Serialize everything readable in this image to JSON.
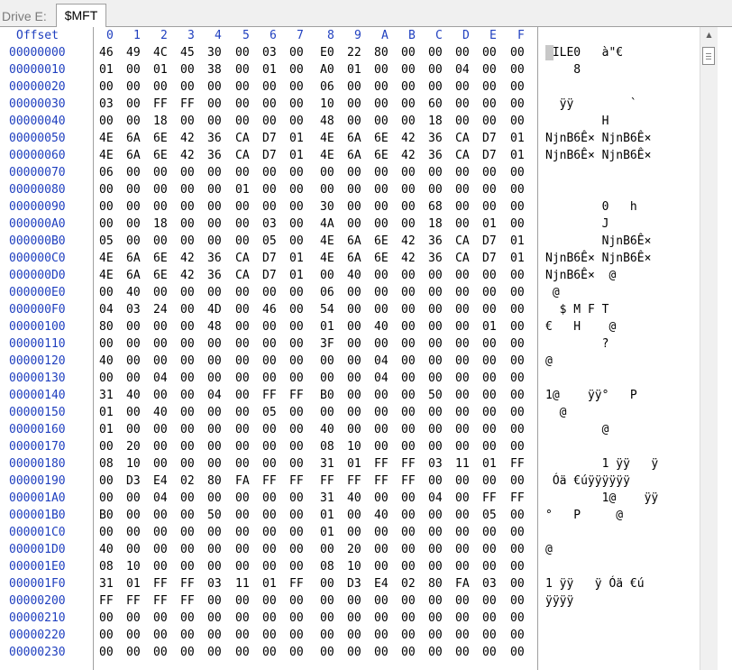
{
  "tabs": {
    "drive_label": "Drive E:",
    "active_label": "$MFT"
  },
  "header": {
    "offset_label": "Offset",
    "columns": [
      "0",
      "1",
      "2",
      "3",
      "4",
      "5",
      "6",
      "7",
      "8",
      "9",
      "A",
      "B",
      "C",
      "D",
      "E",
      "F"
    ]
  },
  "rows": [
    {
      "offset": "00000000",
      "hex": [
        "46",
        "49",
        "4C",
        "45",
        "30",
        "00",
        "03",
        "00",
        "E0",
        "22",
        "80",
        "00",
        "00",
        "00",
        "00",
        "00"
      ],
      "ascii": "FILE0   à\"€"
    },
    {
      "offset": "00000010",
      "hex": [
        "01",
        "00",
        "01",
        "00",
        "38",
        "00",
        "01",
        "00",
        "A0",
        "01",
        "00",
        "00",
        "00",
        "04",
        "00",
        "00"
      ],
      "ascii": "    8"
    },
    {
      "offset": "00000020",
      "hex": [
        "00",
        "00",
        "00",
        "00",
        "00",
        "00",
        "00",
        "00",
        "06",
        "00",
        "00",
        "00",
        "00",
        "00",
        "00",
        "00"
      ],
      "ascii": ""
    },
    {
      "offset": "00000030",
      "hex": [
        "03",
        "00",
        "FF",
        "FF",
        "00",
        "00",
        "00",
        "00",
        "10",
        "00",
        "00",
        "00",
        "60",
        "00",
        "00",
        "00"
      ],
      "ascii": "  ÿÿ        `"
    },
    {
      "offset": "00000040",
      "hex": [
        "00",
        "00",
        "18",
        "00",
        "00",
        "00",
        "00",
        "00",
        "48",
        "00",
        "00",
        "00",
        "18",
        "00",
        "00",
        "00"
      ],
      "ascii": "        H"
    },
    {
      "offset": "00000050",
      "hex": [
        "4E",
        "6A",
        "6E",
        "42",
        "36",
        "CA",
        "D7",
        "01",
        "4E",
        "6A",
        "6E",
        "42",
        "36",
        "CA",
        "D7",
        "01"
      ],
      "ascii": "NjnB6Ê× NjnB6Ê×"
    },
    {
      "offset": "00000060",
      "hex": [
        "4E",
        "6A",
        "6E",
        "42",
        "36",
        "CA",
        "D7",
        "01",
        "4E",
        "6A",
        "6E",
        "42",
        "36",
        "CA",
        "D7",
        "01"
      ],
      "ascii": "NjnB6Ê× NjnB6Ê×"
    },
    {
      "offset": "00000070",
      "hex": [
        "06",
        "00",
        "00",
        "00",
        "00",
        "00",
        "00",
        "00",
        "00",
        "00",
        "00",
        "00",
        "00",
        "00",
        "00",
        "00"
      ],
      "ascii": ""
    },
    {
      "offset": "00000080",
      "hex": [
        "00",
        "00",
        "00",
        "00",
        "00",
        "01",
        "00",
        "00",
        "00",
        "00",
        "00",
        "00",
        "00",
        "00",
        "00",
        "00"
      ],
      "ascii": ""
    },
    {
      "offset": "00000090",
      "hex": [
        "00",
        "00",
        "00",
        "00",
        "00",
        "00",
        "00",
        "00",
        "30",
        "00",
        "00",
        "00",
        "68",
        "00",
        "00",
        "00"
      ],
      "ascii": "        0   h"
    },
    {
      "offset": "000000A0",
      "hex": [
        "00",
        "00",
        "18",
        "00",
        "00",
        "00",
        "03",
        "00",
        "4A",
        "00",
        "00",
        "00",
        "18",
        "00",
        "01",
        "00"
      ],
      "ascii": "        J"
    },
    {
      "offset": "000000B0",
      "hex": [
        "05",
        "00",
        "00",
        "00",
        "00",
        "00",
        "05",
        "00",
        "4E",
        "6A",
        "6E",
        "42",
        "36",
        "CA",
        "D7",
        "01"
      ],
      "ascii": "        NjnB6Ê×"
    },
    {
      "offset": "000000C0",
      "hex": [
        "4E",
        "6A",
        "6E",
        "42",
        "36",
        "CA",
        "D7",
        "01",
        "4E",
        "6A",
        "6E",
        "42",
        "36",
        "CA",
        "D7",
        "01"
      ],
      "ascii": "NjnB6Ê× NjnB6Ê×"
    },
    {
      "offset": "000000D0",
      "hex": [
        "4E",
        "6A",
        "6E",
        "42",
        "36",
        "CA",
        "D7",
        "01",
        "00",
        "40",
        "00",
        "00",
        "00",
        "00",
        "00",
        "00"
      ],
      "ascii": "NjnB6Ê×  @"
    },
    {
      "offset": "000000E0",
      "hex": [
        "00",
        "40",
        "00",
        "00",
        "00",
        "00",
        "00",
        "00",
        "06",
        "00",
        "00",
        "00",
        "00",
        "00",
        "00",
        "00"
      ],
      "ascii": " @"
    },
    {
      "offset": "000000F0",
      "hex": [
        "04",
        "03",
        "24",
        "00",
        "4D",
        "00",
        "46",
        "00",
        "54",
        "00",
        "00",
        "00",
        "00",
        "00",
        "00",
        "00"
      ],
      "ascii": "  $ M F T"
    },
    {
      "offset": "00000100",
      "hex": [
        "80",
        "00",
        "00",
        "00",
        "48",
        "00",
        "00",
        "00",
        "01",
        "00",
        "40",
        "00",
        "00",
        "00",
        "01",
        "00"
      ],
      "ascii": "€   H    @"
    },
    {
      "offset": "00000110",
      "hex": [
        "00",
        "00",
        "00",
        "00",
        "00",
        "00",
        "00",
        "00",
        "3F",
        "00",
        "00",
        "00",
        "00",
        "00",
        "00",
        "00"
      ],
      "ascii": "        ?"
    },
    {
      "offset": "00000120",
      "hex": [
        "40",
        "00",
        "00",
        "00",
        "00",
        "00",
        "00",
        "00",
        "00",
        "00",
        "04",
        "00",
        "00",
        "00",
        "00",
        "00"
      ],
      "ascii": "@"
    },
    {
      "offset": "00000130",
      "hex": [
        "00",
        "00",
        "04",
        "00",
        "00",
        "00",
        "00",
        "00",
        "00",
        "00",
        "04",
        "00",
        "00",
        "00",
        "00",
        "00"
      ],
      "ascii": ""
    },
    {
      "offset": "00000140",
      "hex": [
        "31",
        "40",
        "00",
        "00",
        "04",
        "00",
        "FF",
        "FF",
        "B0",
        "00",
        "00",
        "00",
        "50",
        "00",
        "00",
        "00"
      ],
      "ascii": "1@    ÿÿ°   P"
    },
    {
      "offset": "00000150",
      "hex": [
        "01",
        "00",
        "40",
        "00",
        "00",
        "00",
        "05",
        "00",
        "00",
        "00",
        "00",
        "00",
        "00",
        "00",
        "00",
        "00"
      ],
      "ascii": "  @"
    },
    {
      "offset": "00000160",
      "hex": [
        "01",
        "00",
        "00",
        "00",
        "00",
        "00",
        "00",
        "00",
        "40",
        "00",
        "00",
        "00",
        "00",
        "00",
        "00",
        "00"
      ],
      "ascii": "        @"
    },
    {
      "offset": "00000170",
      "hex": [
        "00",
        "20",
        "00",
        "00",
        "00",
        "00",
        "00",
        "00",
        "08",
        "10",
        "00",
        "00",
        "00",
        "00",
        "00",
        "00"
      ],
      "ascii": ""
    },
    {
      "offset": "00000180",
      "hex": [
        "08",
        "10",
        "00",
        "00",
        "00",
        "00",
        "00",
        "00",
        "31",
        "01",
        "FF",
        "FF",
        "03",
        "11",
        "01",
        "FF"
      ],
      "ascii": "        1 ÿÿ   ÿ"
    },
    {
      "offset": "00000190",
      "hex": [
        "00",
        "D3",
        "E4",
        "02",
        "80",
        "FA",
        "FF",
        "FF",
        "FF",
        "FF",
        "FF",
        "FF",
        "00",
        "00",
        "00",
        "00"
      ],
      "ascii": " Óä €úÿÿÿÿÿÿ"
    },
    {
      "offset": "000001A0",
      "hex": [
        "00",
        "00",
        "04",
        "00",
        "00",
        "00",
        "00",
        "00",
        "31",
        "40",
        "00",
        "00",
        "04",
        "00",
        "FF",
        "FF"
      ],
      "ascii": "        1@    ÿÿ"
    },
    {
      "offset": "000001B0",
      "hex": [
        "B0",
        "00",
        "00",
        "00",
        "50",
        "00",
        "00",
        "00",
        "01",
        "00",
        "40",
        "00",
        "00",
        "00",
        "05",
        "00"
      ],
      "ascii": "°   P     @"
    },
    {
      "offset": "000001C0",
      "hex": [
        "00",
        "00",
        "00",
        "00",
        "00",
        "00",
        "00",
        "00",
        "01",
        "00",
        "00",
        "00",
        "00",
        "00",
        "00",
        "00"
      ],
      "ascii": ""
    },
    {
      "offset": "000001D0",
      "hex": [
        "40",
        "00",
        "00",
        "00",
        "00",
        "00",
        "00",
        "00",
        "00",
        "20",
        "00",
        "00",
        "00",
        "00",
        "00",
        "00"
      ],
      "ascii": "@"
    },
    {
      "offset": "000001E0",
      "hex": [
        "08",
        "10",
        "00",
        "00",
        "00",
        "00",
        "00",
        "00",
        "08",
        "10",
        "00",
        "00",
        "00",
        "00",
        "00",
        "00"
      ],
      "ascii": ""
    },
    {
      "offset": "000001F0",
      "hex": [
        "31",
        "01",
        "FF",
        "FF",
        "03",
        "11",
        "01",
        "FF",
        "00",
        "D3",
        "E4",
        "02",
        "80",
        "FA",
        "03",
        "00"
      ],
      "ascii": "1 ÿÿ   ÿ Óä €ú"
    },
    {
      "offset": "00000200",
      "hex": [
        "FF",
        "FF",
        "FF",
        "FF",
        "00",
        "00",
        "00",
        "00",
        "00",
        "00",
        "00",
        "00",
        "00",
        "00",
        "00",
        "00"
      ],
      "ascii": "ÿÿÿÿ"
    },
    {
      "offset": "00000210",
      "hex": [
        "00",
        "00",
        "00",
        "00",
        "00",
        "00",
        "00",
        "00",
        "00",
        "00",
        "00",
        "00",
        "00",
        "00",
        "00",
        "00"
      ],
      "ascii": ""
    },
    {
      "offset": "00000220",
      "hex": [
        "00",
        "00",
        "00",
        "00",
        "00",
        "00",
        "00",
        "00",
        "00",
        "00",
        "00",
        "00",
        "00",
        "00",
        "00",
        "00"
      ],
      "ascii": ""
    },
    {
      "offset": "00000230",
      "hex": [
        "00",
        "00",
        "00",
        "00",
        "00",
        "00",
        "00",
        "00",
        "00",
        "00",
        "00",
        "00",
        "00",
        "00",
        "00",
        "00"
      ],
      "ascii": ""
    }
  ],
  "icons": {
    "scroll_up": "triangle-up-icon",
    "scroll_thumb": "grip-icon"
  },
  "colors": {
    "offset_text": "#1f3fbf",
    "hex_text": "#000000",
    "grid_line": "#a0a0a0"
  }
}
